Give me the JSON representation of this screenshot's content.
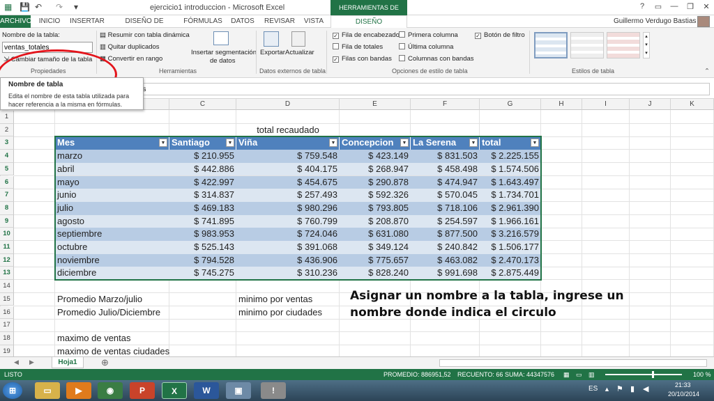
{
  "window": {
    "title": "ejercicio1 introduccion - Microsoft Excel",
    "tools_band": "HERRAMIENTAS DE TABLA",
    "user": "Guillermo Verdugo Bastias",
    "help": "?",
    "minimize": "—",
    "restore": "❐",
    "close": "✕"
  },
  "tabs": [
    "ARCHIVO",
    "INICIO",
    "INSERTAR",
    "DISEÑO DE PÁGINA",
    "FÓRMULAS",
    "DATOS",
    "REVISAR",
    "VISTA",
    "DISEÑO"
  ],
  "ribbon": {
    "propiedades": {
      "name_label": "Nombre de la tabla:",
      "name_value": "ventas_totales",
      "resize": "Cambiar tamaño de la tabla",
      "group": "Propiedades"
    },
    "herramientas": {
      "pivot": "Resumir con tabla dinámica",
      "dedupe": "Quitar duplicados",
      "to_range": "Convertir en rango",
      "slicer_1": "Insertar segmentación",
      "slicer_2": "de datos",
      "group": "Herramientas"
    },
    "externos": {
      "export": "Exportar",
      "refresh": "Actualizar",
      "group": "Datos externos de tabla"
    },
    "opciones": {
      "header_row": "Fila de encabezado",
      "total_row": "Fila de totales",
      "banded_rows": "Filas con bandas",
      "first_col": "Primera columna",
      "last_col": "Última columna",
      "banded_cols": "Columnas con bandas",
      "filter_btn": "Botón de filtro",
      "group": "Opciones de estilo de tabla"
    },
    "estilos": {
      "group": "Estilos de tabla"
    }
  },
  "tooltip": {
    "title": "Nombre de tabla",
    "desc_1": "Edita el nombre de esta tabla utilizada para",
    "desc_2": "hacer referencia a la misma en fórmulas."
  },
  "formula_bar": {
    "value": "es"
  },
  "columns": [
    "C",
    "D",
    "E",
    "F",
    "G",
    "H",
    "I",
    "J",
    "K"
  ],
  "rows": [
    "1",
    "2",
    "3",
    "4",
    "5",
    "6",
    "7",
    "8",
    "9",
    "10",
    "11",
    "12",
    "13",
    "14",
    "15",
    "16",
    "17",
    "18",
    "19"
  ],
  "sheet": {
    "title": "total recaudado",
    "headers": [
      "Mes",
      "Santiago",
      "Viña",
      "Concepcion",
      "La Serena",
      "total"
    ],
    "data": [
      [
        "marzo",
        "$ 210.955",
        "$ 759.548",
        "$ 423.149",
        "$ 831.503",
        "$ 2.225.155"
      ],
      [
        "abril",
        "$ 442.886",
        "$ 404.175",
        "$ 268.947",
        "$ 458.498",
        "$ 1.574.506"
      ],
      [
        "mayo",
        "$ 422.997",
        "$ 454.675",
        "$ 290.878",
        "$ 474.947",
        "$ 1.643.497"
      ],
      [
        "junio",
        "$ 314.837",
        "$ 257.493",
        "$ 592.326",
        "$ 570.045",
        "$ 1.734.701"
      ],
      [
        "julio",
        "$ 469.183",
        "$ 980.296",
        "$ 793.805",
        "$ 718.106",
        "$ 2.961.390"
      ],
      [
        "agosto",
        "$ 741.895",
        "$ 760.799",
        "$ 208.870",
        "$ 254.597",
        "$ 1.966.161"
      ],
      [
        "septiembre",
        "$ 983.953",
        "$ 724.046",
        "$ 631.080",
        "$ 877.500",
        "$ 3.216.579"
      ],
      [
        "octubre",
        "$ 525.143",
        "$ 391.068",
        "$ 349.124",
        "$ 240.842",
        "$ 1.506.177"
      ],
      [
        "noviembre",
        "$ 794.528",
        "$ 436.906",
        "$ 775.657",
        "$ 463.082",
        "$ 2.470.173"
      ],
      [
        "diciembre",
        "$ 745.275",
        "$ 310.236",
        "$ 828.240",
        "$ 991.698",
        "$ 2.875.449"
      ]
    ],
    "label_15b": "Promedio Marzo/julio",
    "label_15d": "minimo por ventas",
    "label_16b": "Promedio Julio/Diciembre",
    "label_16d": "minimo por ciudades",
    "label_18b": "maximo de ventas",
    "label_19b": "maximo de ventas ciudades"
  },
  "note": "Asignar un nombre a la tabla, ingrese un nombre donde indica el circulo",
  "sheet_tab": "Hoja1",
  "status": {
    "ready": "LISTO",
    "promedio": "PROMEDIO: 886951,52",
    "recuento": "RECUENTO: 66",
    "suma": "SUMA: 44347576",
    "zoom": "100 %"
  },
  "taskbar": {
    "lang": "ES",
    "time": "21:33",
    "date": "20/10/2014"
  },
  "colors": {
    "excel_green": "#217346",
    "header_blue": "#4f81bd",
    "band_dark": "#b8cce4",
    "band_light": "#dce6f1",
    "circle_red": "#e3141b"
  }
}
